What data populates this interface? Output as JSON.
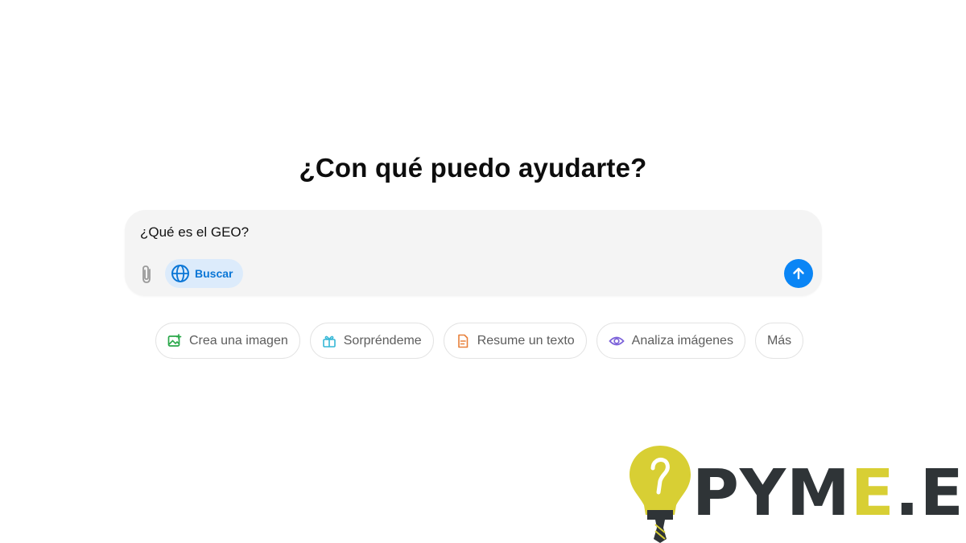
{
  "heading": "¿Con qué puedo ayudarte?",
  "composer": {
    "input_value": "¿Qué es el GEO?",
    "attach_icon": "paperclip-icon",
    "search_label": "Buscar",
    "search_icon": "globe-icon",
    "send_icon": "arrow-up-icon"
  },
  "chips": [
    {
      "label": "Crea una imagen",
      "icon": "image-plus-icon",
      "color": "#2aa84a"
    },
    {
      "label": "Sorpréndeme",
      "icon": "gift-icon",
      "color": "#35b7d6"
    },
    {
      "label": "Resume un texto",
      "icon": "document-icon",
      "color": "#e8803a"
    },
    {
      "label": "Analiza imágenes",
      "icon": "eye-icon",
      "color": "#7b61d9"
    },
    {
      "label": "Más",
      "icon": "",
      "color": "#5d5d5d"
    }
  ],
  "watermark": {
    "text_dark": "PYM",
    "text_accent": "E",
    "text_dark2": ".ES",
    "accent_color": "#d8cf34",
    "dark_color": "#2f3437"
  },
  "colors": {
    "accent": "#0a85f5",
    "search_bg": "#dcebfb",
    "composer_bg": "#f4f4f4"
  }
}
